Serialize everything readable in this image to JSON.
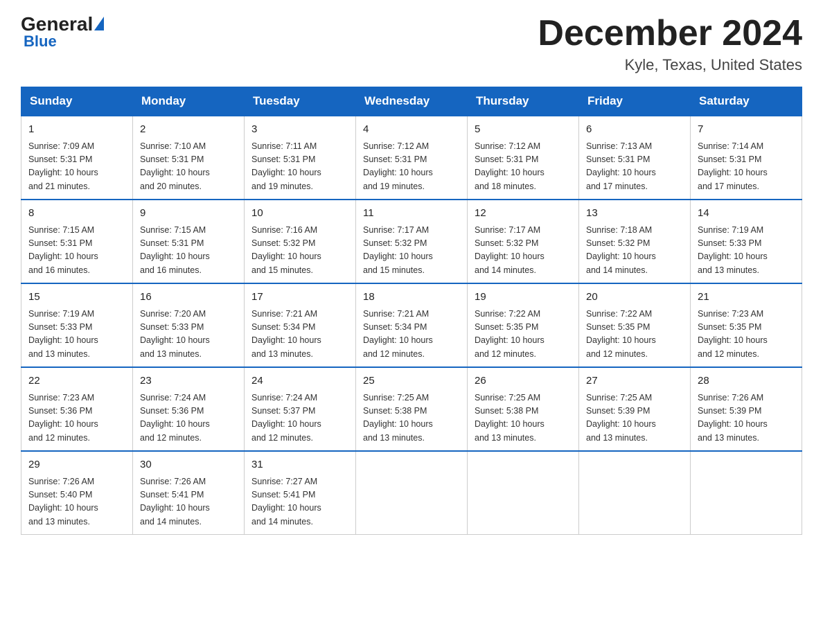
{
  "header": {
    "logo": {
      "general_text": "General",
      "blue_text": "Blue"
    },
    "month_title": "December 2024",
    "location": "Kyle, Texas, United States"
  },
  "days_of_week": [
    "Sunday",
    "Monday",
    "Tuesday",
    "Wednesday",
    "Thursday",
    "Friday",
    "Saturday"
  ],
  "weeks": [
    [
      {
        "day": "1",
        "sunrise": "7:09 AM",
        "sunset": "5:31 PM",
        "daylight": "10 hours and 21 minutes."
      },
      {
        "day": "2",
        "sunrise": "7:10 AM",
        "sunset": "5:31 PM",
        "daylight": "10 hours and 20 minutes."
      },
      {
        "day": "3",
        "sunrise": "7:11 AM",
        "sunset": "5:31 PM",
        "daylight": "10 hours and 19 minutes."
      },
      {
        "day": "4",
        "sunrise": "7:12 AM",
        "sunset": "5:31 PM",
        "daylight": "10 hours and 19 minutes."
      },
      {
        "day": "5",
        "sunrise": "7:12 AM",
        "sunset": "5:31 PM",
        "daylight": "10 hours and 18 minutes."
      },
      {
        "day": "6",
        "sunrise": "7:13 AM",
        "sunset": "5:31 PM",
        "daylight": "10 hours and 17 minutes."
      },
      {
        "day": "7",
        "sunrise": "7:14 AM",
        "sunset": "5:31 PM",
        "daylight": "10 hours and 17 minutes."
      }
    ],
    [
      {
        "day": "8",
        "sunrise": "7:15 AM",
        "sunset": "5:31 PM",
        "daylight": "10 hours and 16 minutes."
      },
      {
        "day": "9",
        "sunrise": "7:15 AM",
        "sunset": "5:31 PM",
        "daylight": "10 hours and 16 minutes."
      },
      {
        "day": "10",
        "sunrise": "7:16 AM",
        "sunset": "5:32 PM",
        "daylight": "10 hours and 15 minutes."
      },
      {
        "day": "11",
        "sunrise": "7:17 AM",
        "sunset": "5:32 PM",
        "daylight": "10 hours and 15 minutes."
      },
      {
        "day": "12",
        "sunrise": "7:17 AM",
        "sunset": "5:32 PM",
        "daylight": "10 hours and 14 minutes."
      },
      {
        "day": "13",
        "sunrise": "7:18 AM",
        "sunset": "5:32 PM",
        "daylight": "10 hours and 14 minutes."
      },
      {
        "day": "14",
        "sunrise": "7:19 AM",
        "sunset": "5:33 PM",
        "daylight": "10 hours and 13 minutes."
      }
    ],
    [
      {
        "day": "15",
        "sunrise": "7:19 AM",
        "sunset": "5:33 PM",
        "daylight": "10 hours and 13 minutes."
      },
      {
        "day": "16",
        "sunrise": "7:20 AM",
        "sunset": "5:33 PM",
        "daylight": "10 hours and 13 minutes."
      },
      {
        "day": "17",
        "sunrise": "7:21 AM",
        "sunset": "5:34 PM",
        "daylight": "10 hours and 13 minutes."
      },
      {
        "day": "18",
        "sunrise": "7:21 AM",
        "sunset": "5:34 PM",
        "daylight": "10 hours and 12 minutes."
      },
      {
        "day": "19",
        "sunrise": "7:22 AM",
        "sunset": "5:35 PM",
        "daylight": "10 hours and 12 minutes."
      },
      {
        "day": "20",
        "sunrise": "7:22 AM",
        "sunset": "5:35 PM",
        "daylight": "10 hours and 12 minutes."
      },
      {
        "day": "21",
        "sunrise": "7:23 AM",
        "sunset": "5:35 PM",
        "daylight": "10 hours and 12 minutes."
      }
    ],
    [
      {
        "day": "22",
        "sunrise": "7:23 AM",
        "sunset": "5:36 PM",
        "daylight": "10 hours and 12 minutes."
      },
      {
        "day": "23",
        "sunrise": "7:24 AM",
        "sunset": "5:36 PM",
        "daylight": "10 hours and 12 minutes."
      },
      {
        "day": "24",
        "sunrise": "7:24 AM",
        "sunset": "5:37 PM",
        "daylight": "10 hours and 12 minutes."
      },
      {
        "day": "25",
        "sunrise": "7:25 AM",
        "sunset": "5:38 PM",
        "daylight": "10 hours and 13 minutes."
      },
      {
        "day": "26",
        "sunrise": "7:25 AM",
        "sunset": "5:38 PM",
        "daylight": "10 hours and 13 minutes."
      },
      {
        "day": "27",
        "sunrise": "7:25 AM",
        "sunset": "5:39 PM",
        "daylight": "10 hours and 13 minutes."
      },
      {
        "day": "28",
        "sunrise": "7:26 AM",
        "sunset": "5:39 PM",
        "daylight": "10 hours and 13 minutes."
      }
    ],
    [
      {
        "day": "29",
        "sunrise": "7:26 AM",
        "sunset": "5:40 PM",
        "daylight": "10 hours and 13 minutes."
      },
      {
        "day": "30",
        "sunrise": "7:26 AM",
        "sunset": "5:41 PM",
        "daylight": "10 hours and 14 minutes."
      },
      {
        "day": "31",
        "sunrise": "7:27 AM",
        "sunset": "5:41 PM",
        "daylight": "10 hours and 14 minutes."
      },
      null,
      null,
      null,
      null
    ]
  ],
  "labels": {
    "sunrise": "Sunrise:",
    "sunset": "Sunset:",
    "daylight": "Daylight:"
  }
}
